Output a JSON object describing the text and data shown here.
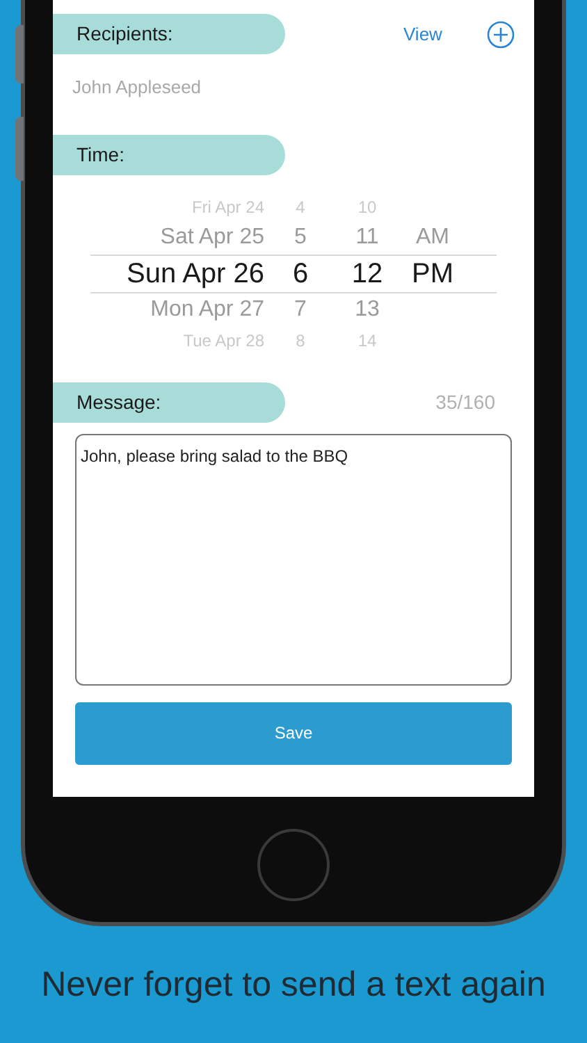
{
  "recipients": {
    "label": "Recipients:",
    "view_link": "View",
    "names": [
      "John Appleseed"
    ]
  },
  "time": {
    "label": "Time:",
    "picker_rows": [
      {
        "date": "Fri Apr 24",
        "hour": "4",
        "minute": "10",
        "selected": false
      },
      {
        "date": "Sat Apr 25",
        "hour": "5",
        "minute": "11",
        "period": "AM",
        "selected": false
      },
      {
        "date": "Sun Apr 26",
        "hour": "6",
        "minute": "12",
        "period": "PM",
        "selected": true
      },
      {
        "date": "Mon Apr 27",
        "hour": "7",
        "minute": "13",
        "selected": false
      },
      {
        "date": "Tue Apr 28",
        "hour": "8",
        "minute": "14",
        "selected": false
      }
    ]
  },
  "message": {
    "label": "Message:",
    "counter": "35/160",
    "value": "John, please bring salad to the BBQ"
  },
  "save_button": "Save",
  "caption": "Never forget to send a text again"
}
